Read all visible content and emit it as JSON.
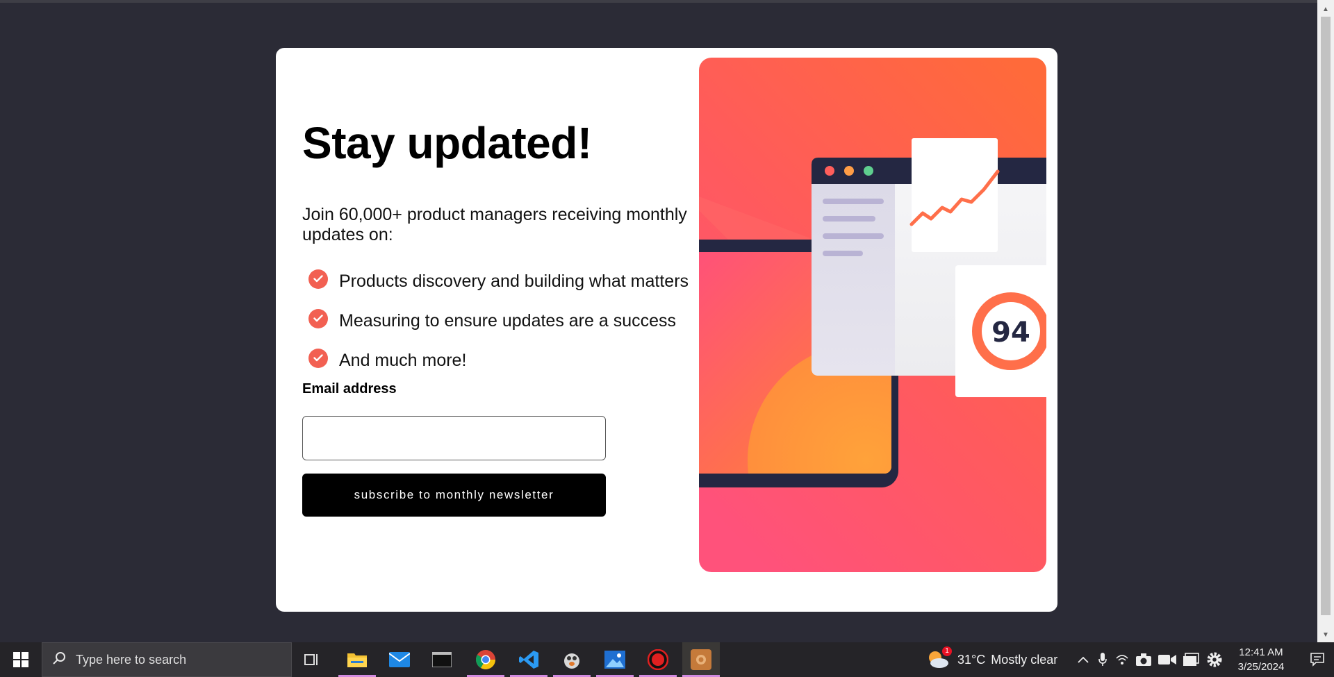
{
  "signup": {
    "title": "Stay updated!",
    "intro": "Join 60,000+ product managers receiving monthly updates on:",
    "benefits": [
      "Products discovery and building what matters",
      "Measuring to ensure updates are a success",
      "And much more!"
    ],
    "email_label": "Email address",
    "email_value": "",
    "subscribe_label": "subscribe to monthly newsletter",
    "illustration": {
      "score": "94",
      "score_fraction": 0.94
    }
  },
  "colors": {
    "page_background": "#2b2b36",
    "accent_tomato": "#f26052",
    "button": "#000000",
    "illustration_gradient": [
      "#ff6a3a",
      "#ff527b"
    ],
    "navy": "#242742"
  },
  "taskbar": {
    "search_placeholder": "Type here to search",
    "apps": [
      "task-view-icon",
      "file-explorer-icon",
      "mail-icon",
      "terminal-icon",
      "chrome-icon",
      "vscode-icon",
      "app-icon",
      "photos-icon",
      "record-icon",
      "media-app-icon"
    ],
    "weather": {
      "badge": "1",
      "temperature": "31°C",
      "condition": "Mostly clear"
    },
    "clock": {
      "time": "12:41 AM",
      "date": "3/25/2024"
    }
  }
}
